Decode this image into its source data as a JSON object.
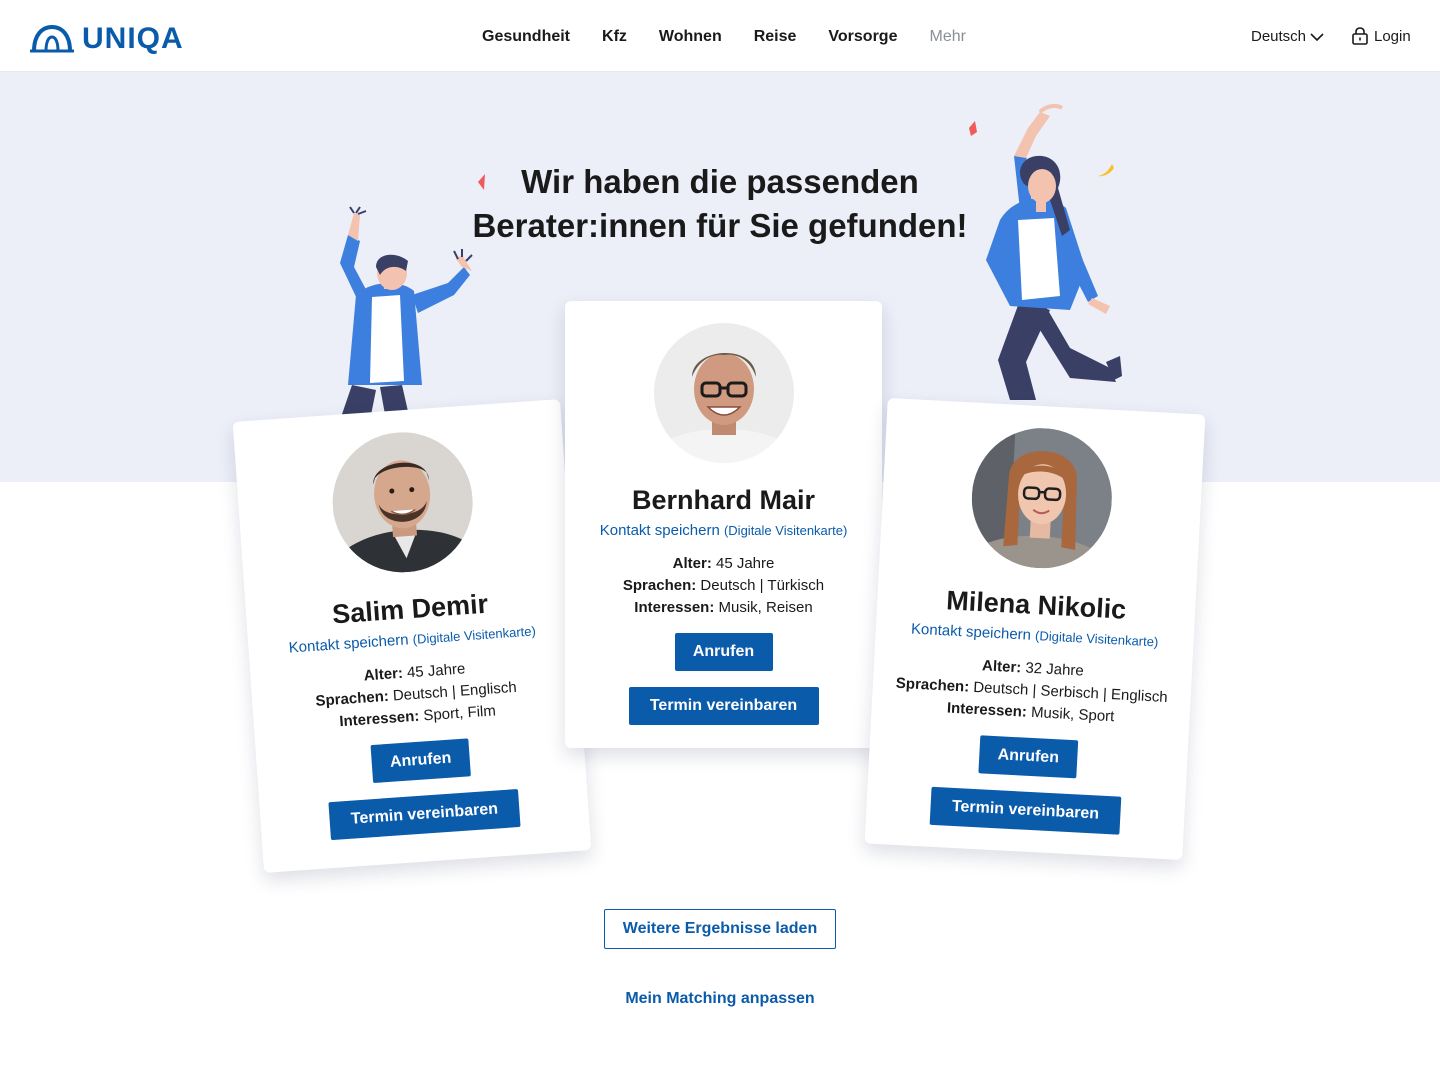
{
  "header": {
    "logo_text": "UNIQA",
    "nav": [
      "Gesundheit",
      "Kfz",
      "Wohnen",
      "Reise",
      "Vorsorge",
      "Mehr"
    ],
    "language": "Deutsch",
    "login": "Login"
  },
  "hero": {
    "headline_line1": "Wir haben die passenden",
    "headline_line2": "Berater:innen für Sie gefunden!"
  },
  "advisors": [
    {
      "name": "Salim Demir",
      "vcard_label": "Kontakt speichern",
      "vcard_sub": "(Digitale Visitenkarte)",
      "age_label": "Alter:",
      "age": "45 Jahre",
      "languages_label": "Sprachen:",
      "languages": "Deutsch | Englisch",
      "interests_label": "Interessen:",
      "interests": "Sport, Film",
      "call_label": "Anrufen",
      "book_label": "Termin vereinbaren"
    },
    {
      "name": "Bernhard Mair",
      "vcard_label": "Kontakt speichern",
      "vcard_sub": "(Digitale Visitenkarte)",
      "age_label": "Alter:",
      "age": "45 Jahre",
      "languages_label": "Sprachen:",
      "languages": "Deutsch | Türkisch",
      "interests_label": "Interessen:",
      "interests": "Musik, Reisen",
      "call_label": "Anrufen",
      "book_label": "Termin vereinbaren"
    },
    {
      "name": "Milena Nikolic",
      "vcard_label": "Kontakt speichern",
      "vcard_sub": "(Digitale Visitenkarte)",
      "age_label": "Alter:",
      "age": "32 Jahre",
      "languages_label": "Sprachen:",
      "languages": "Deutsch | Serbisch | Englisch",
      "interests_label": "Interessen:",
      "interests": "Musik, Sport",
      "call_label": "Anrufen",
      "book_label": "Termin vereinbaren"
    }
  ],
  "actions": {
    "load_more": "Weitere Ergebnisse laden",
    "adjust_matching": "Mein Matching anpassen"
  },
  "colors": {
    "brand_blue": "#0b5bab",
    "hero_bg": "#eceef8",
    "illustration_blue": "#3d7fde",
    "illustration_navy": "#3a3f66"
  }
}
